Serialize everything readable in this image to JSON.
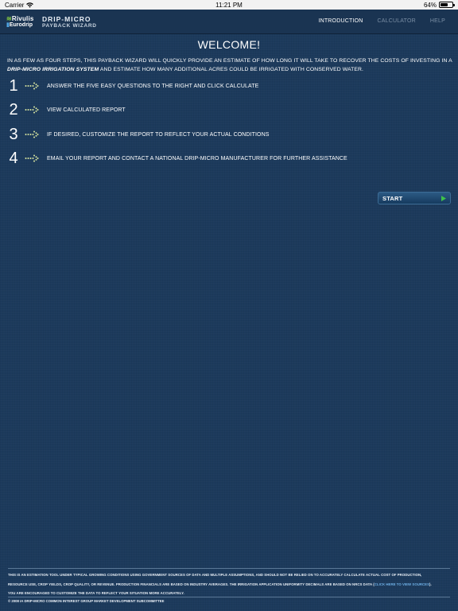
{
  "status_bar": {
    "carrier": "Carrier",
    "time": "11:21 PM",
    "battery": "64%",
    "battery_level": 0.64
  },
  "header": {
    "logo_line1": "Rivulis",
    "logo_line2": "Eurodrip",
    "title_line1": "DRIP-MICRO",
    "title_line2": "PAYBACK WIZARD",
    "nav": [
      {
        "label": "INTRODUCTION",
        "active": true
      },
      {
        "label": "CALCULATOR",
        "active": false
      },
      {
        "label": "HELP",
        "active": false
      }
    ]
  },
  "main": {
    "welcome": "WELCOME!",
    "intro_part1": "IN AS FEW AS FOUR STEPS, THIS PAYBACK WIZARD WILL QUICKLY PROVIDE AN ESTIMATE OF HOW LONG IT WILL TAKE TO RECOVER THE COSTS OF INVESTING IN A",
    "intro_bold": "DRIP-MICRO IRRIGATION SYSTEM",
    "intro_part2": "AND ESTIMATE HOW MANY ADDITIONAL ACRES COULD BE IRRIGATED WITH CONSERVED WATER.",
    "steps": [
      {
        "number": "1",
        "text": "ANSWER THE FIVE EASY QUESTIONS TO THE RIGHT AND CLICK CALCULATE"
      },
      {
        "number": "2",
        "text": "VIEW CALCULATED REPORT"
      },
      {
        "number": "3",
        "text": "IF DESIRED, CUSTOMIZE THE REPORT TO REFLECT YOUR ACTUAL CONDITIONS"
      },
      {
        "number": "4",
        "text": "EMAIL YOUR REPORT AND CONTACT A NATIONAL DRIP-MICRO MANUFACTURER FOR FURTHER ASSISTANCE"
      }
    ],
    "start_label": "START"
  },
  "footer": {
    "disclaimer_line1": "THIS IS AN ESTIMATION TOOL UNDER TYPICAL GROWING CONDITIONS USING GOVERNMENT SOURCES OF DATA AND MULTIPLE ASSUMPTIONS, AND SHOULD NOT BE RELIED ON TO ACCURATELY CALCULATE ACTUAL COST OF PRODUCTION,",
    "disclaimer_line2a": "RESOURCE USE, CROP YIELDS, CROP QUALITY, OR REVENUE. PRODUCTION FINANCIALS ARE BASED ON INDUSTRY AVERAGES. THE IRRIGATION APPLICATION UNIFORMITY DECIMALS ARE BASED ON NRCS DATA (",
    "disclaimer_link": "CLICK HERE TO VIEW SOURCES",
    "disclaimer_line2b": ").",
    "disclaimer_line3": "YOU ARE ENCOURAGED TO CUSTOMIZE THE DATA TO REFLECT YOUR SITUATION MORE ACCURATELY.",
    "copyright": "© 2008 IA DRIP-MICRO COMMON INTEREST GROUP MARKET DEVELOPMENT SUBCOMMITTEE"
  },
  "colors": {
    "background": "#1c3a5c",
    "header": "#1a3452",
    "nav_inactive": "#7a8ea4",
    "arrow_accent": "#d8e6a0",
    "link": "#6fb0e6"
  }
}
